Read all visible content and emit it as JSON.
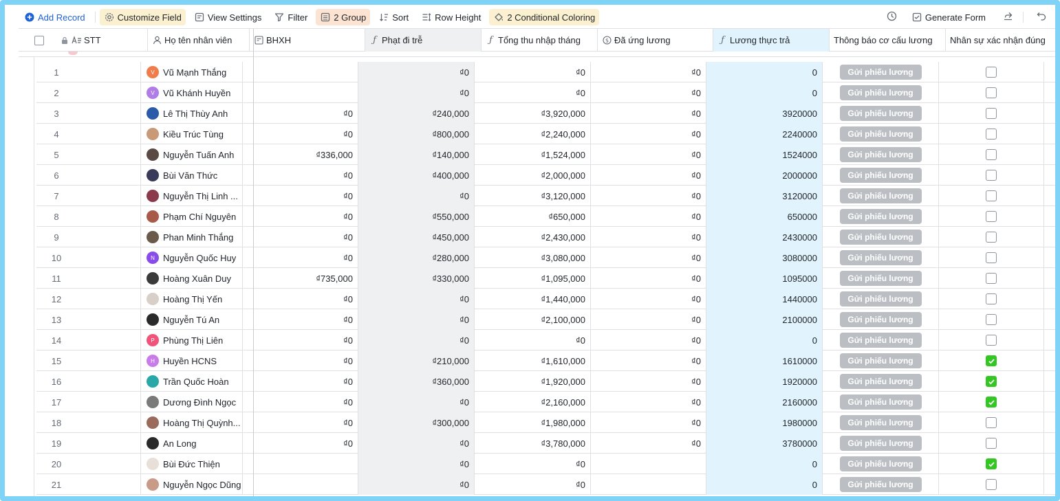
{
  "toolbar": {
    "add_record": "Add Record",
    "customize_field": "Customize Field",
    "view_settings": "View Settings",
    "filter": "Filter",
    "group": "2 Group",
    "sort": "Sort",
    "row_height": "Row Height",
    "conditional_coloring": "2 Conditional Coloring",
    "generate_form": "Generate Form"
  },
  "columns": {
    "stt": "STT",
    "name": "Họ tên nhân viên",
    "bhxh": "BHXH",
    "phat": "Phạt đi trễ",
    "tong": "Tổng thu nhập tháng",
    "daung": "Đã ứng lương",
    "luong": "Lương thực trả",
    "thongbao": "Thông báo cơ cấu lương",
    "xacnhan": "Nhân sự xác nhận đúng"
  },
  "button_label": "Gửi phiếu lương",
  "colors": {
    "accent": "#1f62d6",
    "checked": "#34c724",
    "formula_col": "#eff0f1",
    "highlight_col": "#e1f3fc",
    "frame": "#7fd3f7"
  },
  "rows": [
    {
      "stt": "1",
      "name": "Vũ Mạnh Thắng",
      "avatar": "V",
      "avatar_color": "#f07c4c",
      "bhxh": "",
      "phat": "₫0",
      "tong": "₫0",
      "daung": "₫0",
      "luong": "0",
      "confirmed": false
    },
    {
      "stt": "2",
      "name": "Vũ Khánh Huyền",
      "avatar": "V",
      "avatar_color": "#b07ce8",
      "bhxh": "",
      "phat": "₫0",
      "tong": "₫0",
      "daung": "₫0",
      "luong": "0",
      "confirmed": false
    },
    {
      "stt": "3",
      "name": "Lê Thị Thùy Anh",
      "avatar": "",
      "avatar_color": "#2a5aa8",
      "bhxh": "₫0",
      "phat": "₫240,000",
      "tong": "₫3,920,000",
      "daung": "₫0",
      "luong": "3920000",
      "confirmed": false
    },
    {
      "stt": "4",
      "name": "Kiều Trúc Tùng",
      "avatar": "",
      "avatar_color": "#c89a78",
      "bhxh": "₫0",
      "phat": "₫800,000",
      "tong": "₫2,240,000",
      "daung": "₫0",
      "luong": "2240000",
      "confirmed": false
    },
    {
      "stt": "5",
      "name": "Nguyễn Tuấn Anh",
      "avatar": "",
      "avatar_color": "#5a4a44",
      "bhxh": "₫336,000",
      "phat": "₫140,000",
      "tong": "₫1,524,000",
      "daung": "₫0",
      "luong": "1524000",
      "confirmed": false
    },
    {
      "stt": "6",
      "name": "Bùi Văn Thức",
      "avatar": "",
      "avatar_color": "#3a3a5a",
      "bhxh": "₫0",
      "phat": "₫400,000",
      "tong": "₫2,000,000",
      "daung": "₫0",
      "luong": "2000000",
      "confirmed": false
    },
    {
      "stt": "7",
      "name": "Nguyễn Thị Linh ...",
      "avatar": "",
      "avatar_color": "#8a3a4a",
      "bhxh": "₫0",
      "phat": "₫0",
      "tong": "₫3,120,000",
      "daung": "₫0",
      "luong": "3120000",
      "confirmed": false
    },
    {
      "stt": "8",
      "name": "Phạm Chí Nguyên",
      "avatar": "",
      "avatar_color": "#a85a4a",
      "bhxh": "₫0",
      "phat": "₫550,000",
      "tong": "₫650,000",
      "daung": "₫0",
      "luong": "650000",
      "confirmed": false
    },
    {
      "stt": "9",
      "name": "Phan Minh Thắng",
      "avatar": "",
      "avatar_color": "#6a5a4a",
      "bhxh": "₫0",
      "phat": "₫450,000",
      "tong": "₫2,430,000",
      "daung": "₫0",
      "luong": "2430000",
      "confirmed": false
    },
    {
      "stt": "10",
      "name": "Nguyễn Quốc Huy",
      "avatar": "N",
      "avatar_color": "#8a4ce8",
      "bhxh": "₫0",
      "phat": "₫280,000",
      "tong": "₫3,080,000",
      "daung": "₫0",
      "luong": "3080000",
      "confirmed": false
    },
    {
      "stt": "11",
      "name": "Hoàng Xuân Duy",
      "avatar": "",
      "avatar_color": "#3a3a3a",
      "bhxh": "₫735,000",
      "phat": "₫330,000",
      "tong": "₫1,095,000",
      "daung": "₫0",
      "luong": "1095000",
      "confirmed": false
    },
    {
      "stt": "12",
      "name": "Hoàng Thị Yến",
      "avatar": "",
      "avatar_color": "#d8d0c8",
      "bhxh": "₫0",
      "phat": "₫0",
      "tong": "₫1,440,000",
      "daung": "₫0",
      "luong": "1440000",
      "confirmed": false
    },
    {
      "stt": "13",
      "name": "Nguyễn Tú An",
      "avatar": "",
      "avatar_color": "#2a2a2a",
      "bhxh": "₫0",
      "phat": "₫0",
      "tong": "₫2,100,000",
      "daung": "₫0",
      "luong": "2100000",
      "confirmed": false
    },
    {
      "stt": "14",
      "name": "Phùng Thị Liên",
      "avatar": "P",
      "avatar_color": "#f0547a",
      "bhxh": "₫0",
      "phat": "₫0",
      "tong": "₫0",
      "daung": "₫0",
      "luong": "0",
      "confirmed": false
    },
    {
      "stt": "15",
      "name": "Huyền HCNS",
      "avatar": "H",
      "avatar_color": "#c87ce8",
      "bhxh": "₫0",
      "phat": "₫210,000",
      "tong": "₫1,610,000",
      "daung": "₫0",
      "luong": "1610000",
      "confirmed": true
    },
    {
      "stt": "16",
      "name": "Trần Quốc Hoàn",
      "avatar": "",
      "avatar_color": "#2aa8a8",
      "bhxh": "₫0",
      "phat": "₫360,000",
      "tong": "₫1,920,000",
      "daung": "₫0",
      "luong": "1920000",
      "confirmed": true
    },
    {
      "stt": "17",
      "name": "Dương Đình Ngọc",
      "avatar": "",
      "avatar_color": "#7a7a7a",
      "bhxh": "₫0",
      "phat": "₫0",
      "tong": "₫2,160,000",
      "daung": "₫0",
      "luong": "2160000",
      "confirmed": true
    },
    {
      "stt": "18",
      "name": "Hoàng Thị Quỳnh...",
      "avatar": "",
      "avatar_color": "#9a6a5a",
      "bhxh": "₫0",
      "phat": "₫300,000",
      "tong": "₫1,980,000",
      "daung": "₫0",
      "luong": "1980000",
      "confirmed": false
    },
    {
      "stt": "19",
      "name": "An Long",
      "avatar": "",
      "avatar_color": "#2a2a2a",
      "bhxh": "₫0",
      "phat": "₫0",
      "tong": "₫3,780,000",
      "daung": "₫0",
      "luong": "3780000",
      "confirmed": false
    },
    {
      "stt": "20",
      "name": "Bùi Đức Thiện",
      "avatar": "",
      "avatar_color": "#e8e0d8",
      "bhxh": "",
      "phat": "₫0",
      "tong": "₫0",
      "daung": "",
      "luong": "0",
      "confirmed": true
    },
    {
      "stt": "21",
      "name": "Nguyễn Ngọc Dũng",
      "avatar": "",
      "avatar_color": "#c89a88",
      "bhxh": "",
      "phat": "₫0",
      "tong": "₫0",
      "daung": "",
      "luong": "0",
      "confirmed": false
    }
  ]
}
